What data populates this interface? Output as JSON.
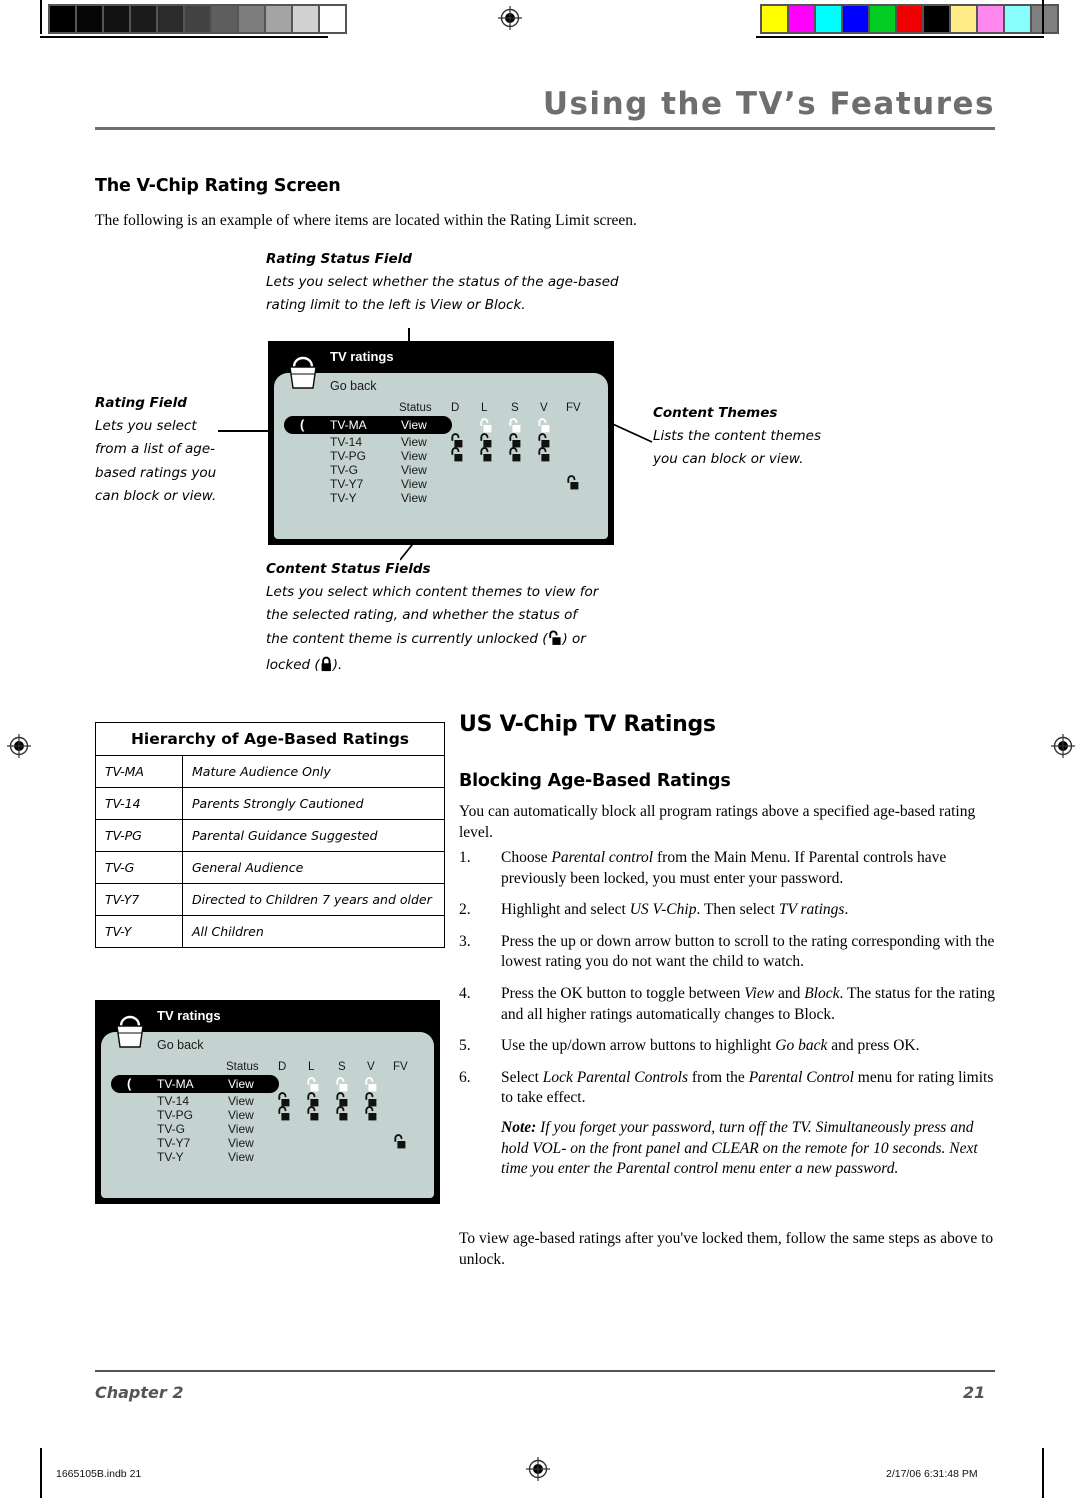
{
  "calibration": {
    "gray_bar_name": "grayscale-calibration-bar",
    "gray_swatches": [
      "#000000",
      "#060606",
      "#111111",
      "#1b1b1b",
      "#2b2b2b",
      "#434343",
      "#5e5e5e",
      "#7d7d7d",
      "#a4a4a4",
      "#d2d2d2",
      "#ffffff"
    ],
    "color_bar_name": "color-calibration-bar",
    "color_swatches": [
      "#ffff00",
      "#ff00ff",
      "#00ffff",
      "#0000ff",
      "#00cc22",
      "#ee0000",
      "#000000",
      "#ffee88",
      "#ff88ee",
      "#88ffff",
      "#808080"
    ]
  },
  "header": {
    "title": "Using the TV’s Features"
  },
  "section_left": {
    "heading": "The V-Chip Rating Screen",
    "intro": "The following is an example of where items are located within the Rating Limit screen."
  },
  "callouts": {
    "rating_status": {
      "title": "Rating Status Field",
      "line1": "Lets you select whether the status of the age-based",
      "line2": "rating limit to the left is View or Block."
    },
    "rating_field": {
      "title": "Rating Field",
      "line1": "Lets you select",
      "line2": "from a list of age-",
      "line3": "based ratings you",
      "line4": "can block or view."
    },
    "content_themes": {
      "title": "Content Themes",
      "line1": "Lists the content themes",
      "line2": "you can block or view."
    },
    "content_status": {
      "title": "Content Status Fields",
      "line1": "Lets you select which content themes to view for",
      "line2": "the selected rating, and whether the status of",
      "line3a": "the content theme is currently unlocked (",
      "line3b": ") or",
      "line4a": "locked (",
      "line4b": ")."
    }
  },
  "osd": {
    "title": "TV ratings",
    "go_back": "Go back",
    "status_header": "Status",
    "theme_headers": [
      "D",
      "L",
      "S",
      "V",
      "FV"
    ],
    "selected_marker": "(",
    "rows": [
      {
        "rating": "TV-MA",
        "status": "View",
        "selected": true,
        "locks": [
          null,
          "unlocked-white",
          "unlocked-white",
          "unlocked-white",
          null
        ]
      },
      {
        "rating": "TV-14",
        "status": "View",
        "selected": false,
        "locks": [
          "unlocked-dark",
          "unlocked-dark",
          "unlocked-dark",
          "unlocked-dark",
          null
        ]
      },
      {
        "rating": "TV-PG",
        "status": "View",
        "selected": false,
        "locks": [
          "unlocked-dark",
          "unlocked-dark",
          "unlocked-dark",
          "unlocked-dark",
          null
        ]
      },
      {
        "rating": "TV-G",
        "status": "View",
        "selected": false,
        "locks": [
          null,
          null,
          null,
          null,
          null
        ]
      },
      {
        "rating": "TV-Y7",
        "status": "View",
        "selected": false,
        "locks": [
          null,
          null,
          null,
          null,
          "unlocked-dark"
        ]
      },
      {
        "rating": "TV-Y",
        "status": "View",
        "selected": false,
        "locks": [
          null,
          null,
          null,
          null,
          null
        ]
      }
    ],
    "bg_color": "#c4d2d0",
    "bar_color": "#000000"
  },
  "hierarchy_table": {
    "title": "Hierarchy of Age-Based Ratings",
    "rows": [
      {
        "code": "TV-MA",
        "desc": "Mature Audience Only"
      },
      {
        "code": "TV-14",
        "desc": "Parents Strongly Cautioned"
      },
      {
        "code": "TV-PG",
        "desc": "Parental Guidance Suggested"
      },
      {
        "code": "TV-G",
        "desc": "General Audience"
      },
      {
        "code": "TV-Y7",
        "desc": "Directed to Children 7 years and older"
      },
      {
        "code": "TV-Y",
        "desc": "All Children"
      }
    ]
  },
  "section_right": {
    "heading": "US V-Chip TV Ratings",
    "subheading": "Blocking Age-Based Ratings",
    "intro": "You can automatically block all program ratings above a specified age-based rating level.",
    "steps": [
      {
        "num": "1.",
        "pre": "Choose ",
        "em1": "Parental control",
        "mid": " from the Main Menu. If Parental controls have previously been locked, you must enter your password.",
        "em2": "",
        "post": ""
      },
      {
        "num": "2.",
        "pre": "Highlight and select ",
        "em1": "US V-Chip",
        "mid": ". Then select ",
        "em2": "TV ratings",
        "post": "."
      },
      {
        "num": "3.",
        "pre": "Press the up or down arrow button to scroll to the rating corresponding with the lowest rating you do not want the child to watch.",
        "em1": "",
        "mid": "",
        "em2": "",
        "post": ""
      },
      {
        "num": "4.",
        "pre": "Press the OK button to toggle between ",
        "em1": "View",
        "mid": " and ",
        "em2": "Block",
        "post": ". The status for the rating and all higher ratings automatically changes to Block."
      },
      {
        "num": "5.",
        "pre": "Use the up/down arrow buttons to highlight ",
        "em1": "Go back",
        "mid": " and press OK.",
        "em2": "",
        "post": ""
      },
      {
        "num": "6.",
        "pre": "Select ",
        "em1": "Lock Parental Controls",
        "mid": " from the ",
        "em2": "Parental Control",
        "post": " menu for rating limits to take effect."
      }
    ],
    "note_label": "Note:",
    "note_text": " If you forget your password, turn off the TV. Simultaneously press and hold VOL- on the front panel and CLEAR on the remote for 10 seconds. Next time you enter the Parental control menu enter a new password.",
    "closing": "To view age-based ratings after you've locked them, follow the same steps as above to unlock."
  },
  "footer": {
    "chapter": "Chapter 2",
    "page_number": "21",
    "file_name": "1665105B.indb   21",
    "print_stamp": "2/17/06   6:31:48 PM"
  }
}
